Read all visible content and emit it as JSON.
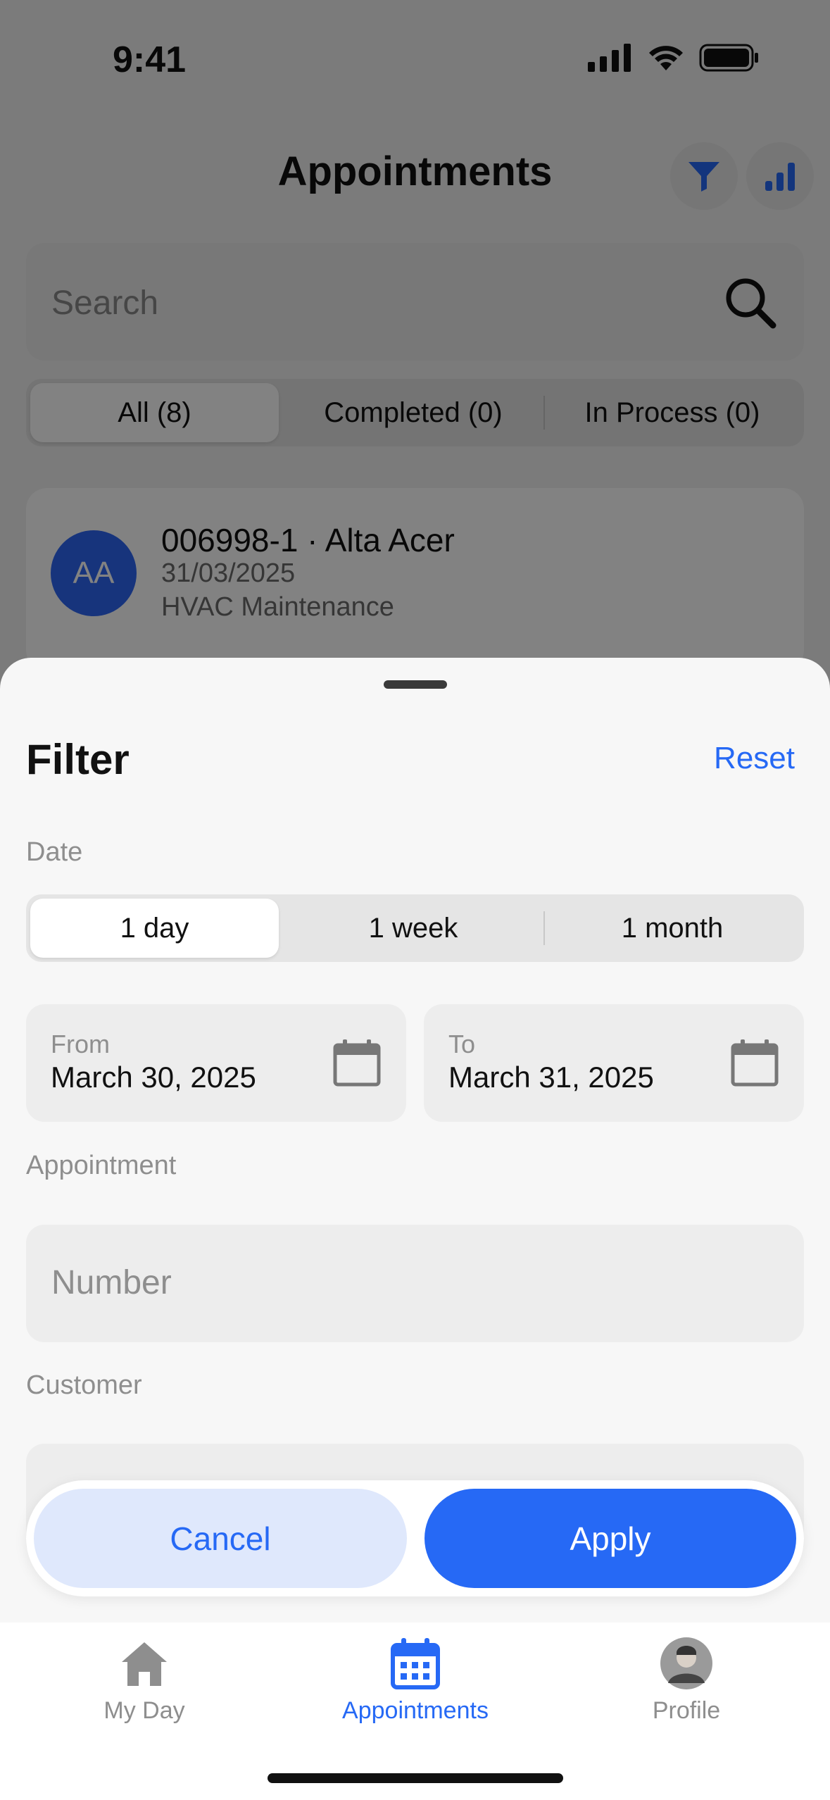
{
  "status_bar": {
    "time": "9:41"
  },
  "header": {
    "title": "Appointments"
  },
  "search": {
    "placeholder": "Search"
  },
  "list_filter": {
    "options": [
      {
        "label": "All (8)",
        "active": true
      },
      {
        "label": "Completed (0)",
        "active": false
      },
      {
        "label": "In Process (0)",
        "active": false
      }
    ]
  },
  "appointment_card": {
    "initials": "AA",
    "title": "006998-1 · Alta Acer",
    "date": "31/03/2025",
    "service": "HVAC Maintenance"
  },
  "filter_sheet": {
    "title": "Filter",
    "reset_label": "Reset",
    "date_label": "Date",
    "range_options": [
      {
        "label": "1 day",
        "active": true
      },
      {
        "label": "1 week",
        "active": false
      },
      {
        "label": "1 month",
        "active": false
      }
    ],
    "from": {
      "caption": "From",
      "value": "March 30, 2025"
    },
    "to": {
      "caption": "To",
      "value": "March 31, 2025"
    },
    "appointment_label": "Appointment",
    "number_placeholder": "Number",
    "customer_label": "Customer",
    "cancel_label": "Cancel",
    "apply_label": "Apply"
  },
  "tab_bar": {
    "tabs": [
      {
        "label": "My Day",
        "active": false
      },
      {
        "label": "Appointments",
        "active": true
      },
      {
        "label": "Profile",
        "active": false
      }
    ]
  },
  "colors": {
    "accent": "#2669f5",
    "avatar_bg": "#2d67f4",
    "cancel_bg": "#dfe8fc",
    "inactive_tab": "#8e8e8e"
  }
}
